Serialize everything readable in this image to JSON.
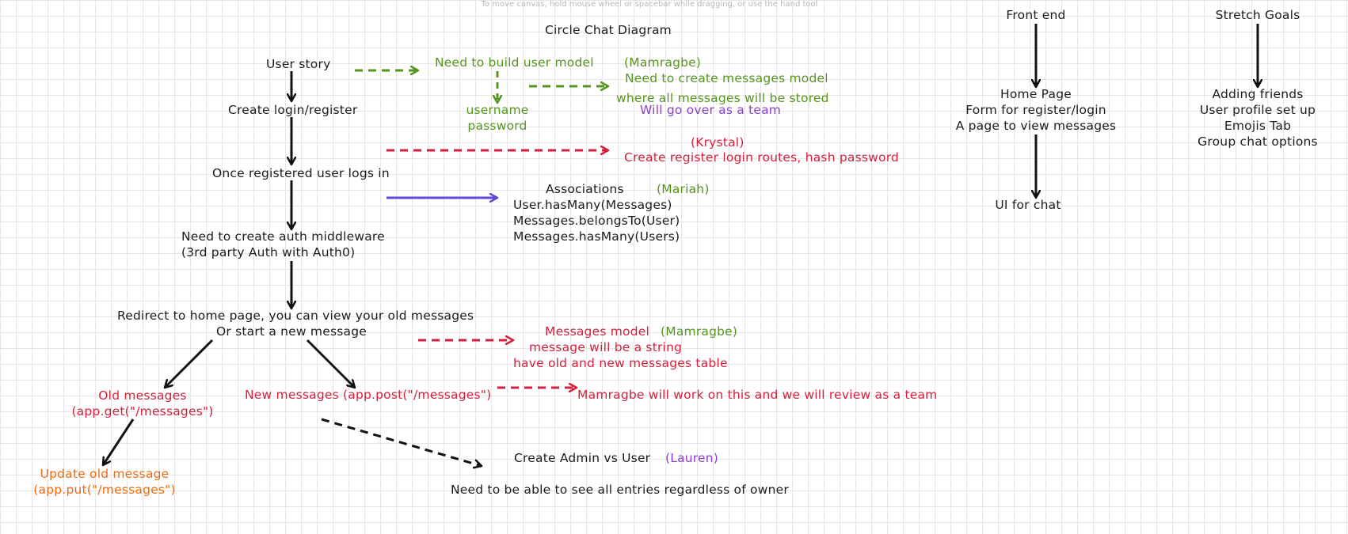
{
  "hint": "To move canvas, hold mouse wheel or spacebar while dragging, or use the hand tool",
  "title": "Circle Chat Diagram",
  "main_flow": {
    "user_story": "User story",
    "create_login": "Create login/register",
    "logs_in": "Once registered user logs in",
    "auth_line1": "Need to create auth middleware",
    "auth_line2": "(3rd party Auth with Auth0)",
    "redirect_line1": "Redirect to home page, you can view your old messages",
    "redirect_line2": "Or start a new message",
    "old_line1": "Old messages",
    "old_line2": "(app.get(\"/messages\")",
    "new_messages": "New messages (app.post(\"/messages\")",
    "update_line1": "Update old message",
    "update_line2": "(app.put(\"/messages\")"
  },
  "notes": {
    "user_model": "Need to build user model",
    "mamragbe1": "(Mamragbe)",
    "messages_model_line1": "Need to create messages model",
    "messages_model_line2": "where all messages will be stored",
    "team_note": "Will go over as a team",
    "username": "username",
    "password": "password",
    "krystal": "(Krystal)",
    "routes": "Create register login routes, hash password",
    "associations": "Associations",
    "mariah": "(Mariah)",
    "assoc1": "User.hasMany(Messages)",
    "assoc2": "Messages.belongsTo(User)",
    "assoc3": "Messages.hasMany(Users)",
    "messages_model": "Messages model",
    "mamragbe2": "(Mamragbe)",
    "string": "message will be a string",
    "table": "have old and new messages table",
    "review": "Mamragbe will work on this and we will review as a team",
    "admin": "Create Admin vs User",
    "lauren": "(Lauren)",
    "entries": "Need to be able to see all entries regardless of owner"
  },
  "frontend": {
    "header": "Front end",
    "home": "Home Page",
    "form": "Form for register/login",
    "view": "A page to view messages",
    "ui": "UI for chat"
  },
  "stretch": {
    "header": "Stretch Goals",
    "items": [
      "Adding friends",
      "User profile set up",
      "Emojis Tab",
      "Group chat options"
    ]
  },
  "colors": {
    "black": "#1c1c1c",
    "green": "#55951f",
    "red": "#d31f3b",
    "purple": "#8a3fc9",
    "orange": "#ef6b10",
    "blue": "#6347d6"
  }
}
